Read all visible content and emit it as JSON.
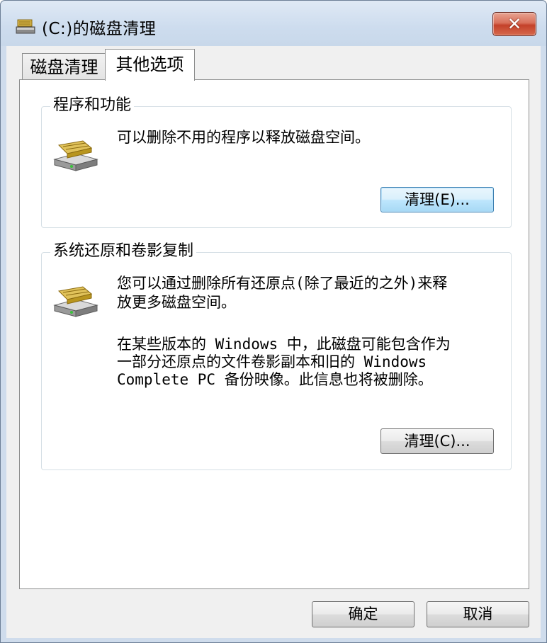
{
  "window": {
    "title": "(C:)的磁盘清理",
    "close_label": "✕",
    "icon": "disk-cleanup-icon"
  },
  "tabs": [
    {
      "label": "磁盘清理",
      "active": false
    },
    {
      "label": "其他选项",
      "active": true
    }
  ],
  "programs": {
    "legend": "程序和功能",
    "icon": "drive-icon",
    "description": "可以删除不用的程序以释放磁盘空间。",
    "button_label": "清理(E)..."
  },
  "restore": {
    "legend": "系统还原和卷影复制",
    "icon": "drive-icon",
    "description_1_line1": "您可以通过删除所有还原点(除了最近的之外)来释",
    "description_1_line2": "放更多磁盘空间。",
    "description_2_line1": "在某些版本的 Windows 中，此磁盘可能包含作为",
    "description_2_line2": "一部分还原点的文件卷影副本和旧的 Windows",
    "description_2_line3": "Complete PC 备份映像。此信息也将被删除。",
    "button_label": "清理(C)..."
  },
  "footer": {
    "ok_label": "确定",
    "cancel_label": "取消"
  },
  "colors": {
    "accent_focus": "#3c7fb1",
    "close_red": "#c4412a",
    "frame": "#cfdcec"
  }
}
